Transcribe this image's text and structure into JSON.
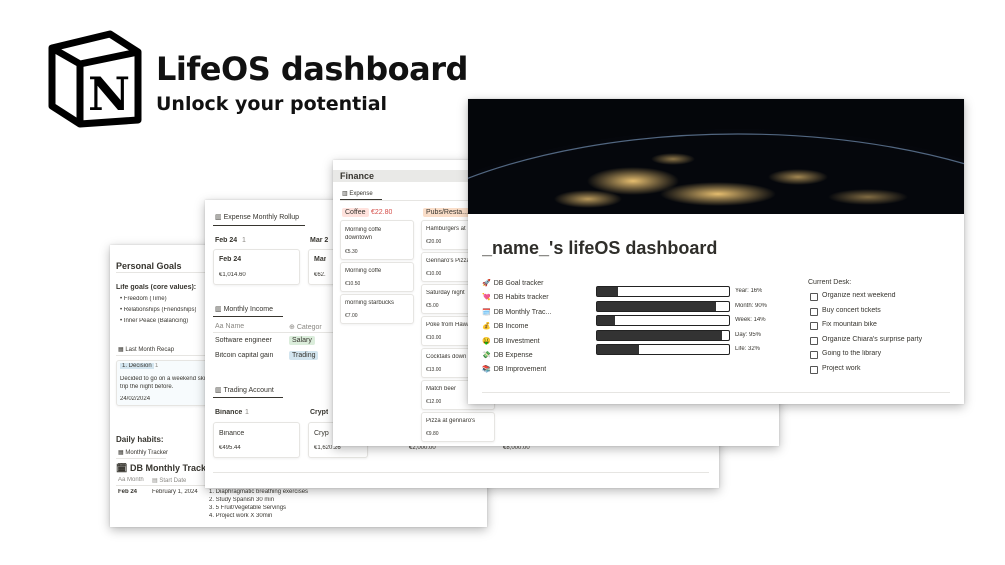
{
  "brand": {
    "title": "LifeOS dashboard",
    "subtitle": "Unlock your potential",
    "logo_letter": "N"
  },
  "card1": {
    "personal_goals": "Personal Goals",
    "life_goals_heading": "Life goals (core values):",
    "life_goals": [
      "Freedom (Time)",
      "Relationships (Friendships)",
      "Inner Peace (Balancing)"
    ],
    "recap_tab": "Last Month Recap",
    "decision_label": "1. Decision",
    "decision_count": "1",
    "decision_text_1": "Decided to go on a weekend skiing",
    "decision_text_2": "trip the night before.",
    "decision_date": "24/02/2024",
    "daily_habits": "Daily habits:",
    "tracker_tab": "Monthly Tracker",
    "tracker_title": "DB Monthly Tracker",
    "col_month": "Month",
    "col_start": "Start Date",
    "row_month": "Feb 24",
    "row_date": "February 1, 2024",
    "habits": [
      "1. Diaphragmatic breathing exercises",
      "2. Study Spanish 30 min",
      "3. 5 Fruit/Vegetable Servings",
      "4. Project work X 30min"
    ]
  },
  "card2": {
    "expense_rollup": "Expense Monthly Rollup",
    "group_feb": "Feb 24",
    "group_feb_count": "1",
    "group_mar": "Mar 2",
    "feb_card_title": "Feb 24",
    "feb_card_value": "€1,014.60",
    "mar_card_title": "Mar",
    "mar_card_value": "€62.",
    "monthly_income": "Monthly Income",
    "col_name": "Name",
    "col_category": "Categor",
    "income_rows": [
      {
        "name": "Software engineer",
        "category": "Salary"
      },
      {
        "name": "Bitcoin capital gain",
        "category": "Trading"
      }
    ],
    "trading_account": "Trading Account",
    "group_binance": "Binance",
    "group_binance_count": "1",
    "group_crypto": "Crypt",
    "binance_card_title": "Binance",
    "binance_card_value": "€495.44",
    "crypto_card_title": "Cryp",
    "crypto_card_value": "€1,620.26",
    "extra_values": [
      "€2,000.00",
      "€8,000.00"
    ]
  },
  "card3": {
    "finance": "Finance",
    "expense_tab": "Expense",
    "coffee_tag": "Coffee",
    "coffee_total": "€22.80",
    "pubs_tag": "Pubs/Resta...",
    "coffee_items": [
      {
        "name_1": "Morning coffe",
        "name_2": "downtown",
        "price": "€5.30"
      },
      {
        "name_1": "Morning coffe",
        "name_2": "",
        "price": "€10.50"
      },
      {
        "name_1": "morning starbucks",
        "name_2": "",
        "price": "€7.00"
      }
    ],
    "pubs_items": [
      {
        "name": "Hamburgers at",
        "price": "€20.00"
      },
      {
        "name": "Gennaro's Pizza",
        "price": "€10.00"
      },
      {
        "name": "Saturday night",
        "price": "€5.00"
      },
      {
        "name": "Poke from Hawa",
        "price": "€10.00"
      },
      {
        "name": "Cocktails down",
        "price": "€13.00"
      },
      {
        "name": "Match beer",
        "price": "€12.00"
      },
      {
        "name": "Pizza at gennaro's",
        "price": "€9.80"
      }
    ]
  },
  "card4": {
    "title": "_name_'s lifeOS dashboard",
    "databases": [
      {
        "icon": "🚀",
        "label": "DB Goal tracker"
      },
      {
        "icon": "💘",
        "label": "DB Habits tracker"
      },
      {
        "icon": "🗓️",
        "label": "DB Monthly Trac..."
      },
      {
        "icon": "💰",
        "label": "DB Income"
      },
      {
        "icon": "🤑",
        "label": "DB Investment"
      },
      {
        "icon": "💸",
        "label": "DB Expense"
      },
      {
        "icon": "📚",
        "label": "DB Improvement"
      }
    ],
    "progress": [
      {
        "label": "Year: 16%",
        "value": 0.16
      },
      {
        "label": "Month: 90%",
        "value": 0.9
      },
      {
        "label": "Week: 14%",
        "value": 0.14
      },
      {
        "label": "Day: 95%",
        "value": 0.95
      },
      {
        "label": "Life: 32%",
        "value": 0.32
      }
    ],
    "desk_heading": "Current Desk:",
    "desk_items": [
      "Organize next weekend",
      "Buy concert tickets",
      "Fix mountain bike",
      "Organize Chiara's surprise party",
      "Going to the library",
      "Project work"
    ]
  }
}
